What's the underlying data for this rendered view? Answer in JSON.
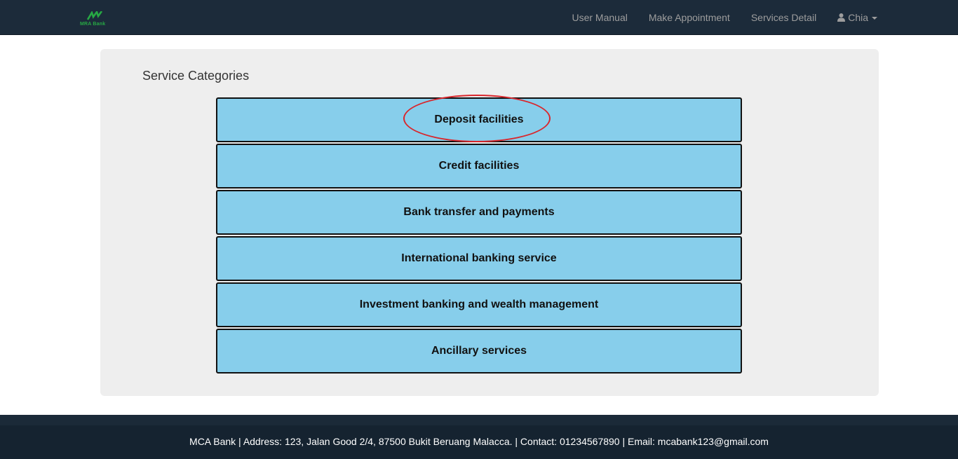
{
  "navbar": {
    "brand_text": "MRA Bank",
    "links": [
      "User Manual",
      "Make Appointment",
      "Services Detail"
    ],
    "user_name": "Chia",
    "user_icon": "user-icon",
    "colors": {
      "bg": "#1c2b3a",
      "link": "#9d9d9d",
      "brand": "#27a844"
    }
  },
  "panel": {
    "title": "Service Categories",
    "categories": [
      "Deposit facilities",
      "Credit facilities",
      "Bank transfer and payments",
      "International banking service",
      "Investment banking and wealth management",
      "Ancillary services"
    ],
    "highlighted": "Deposit facilities",
    "colors": {
      "button_bg": "#87ceeb",
      "highlight": "#d9262c",
      "panel_bg": "#eeeeee"
    }
  },
  "footer": {
    "text": "MCA Bank | Address: 123, Jalan Good 2/4, 87500 Bukit Beruang Malacca. | Contact: 01234567890 | Email: mcabank123@gmail.com"
  }
}
